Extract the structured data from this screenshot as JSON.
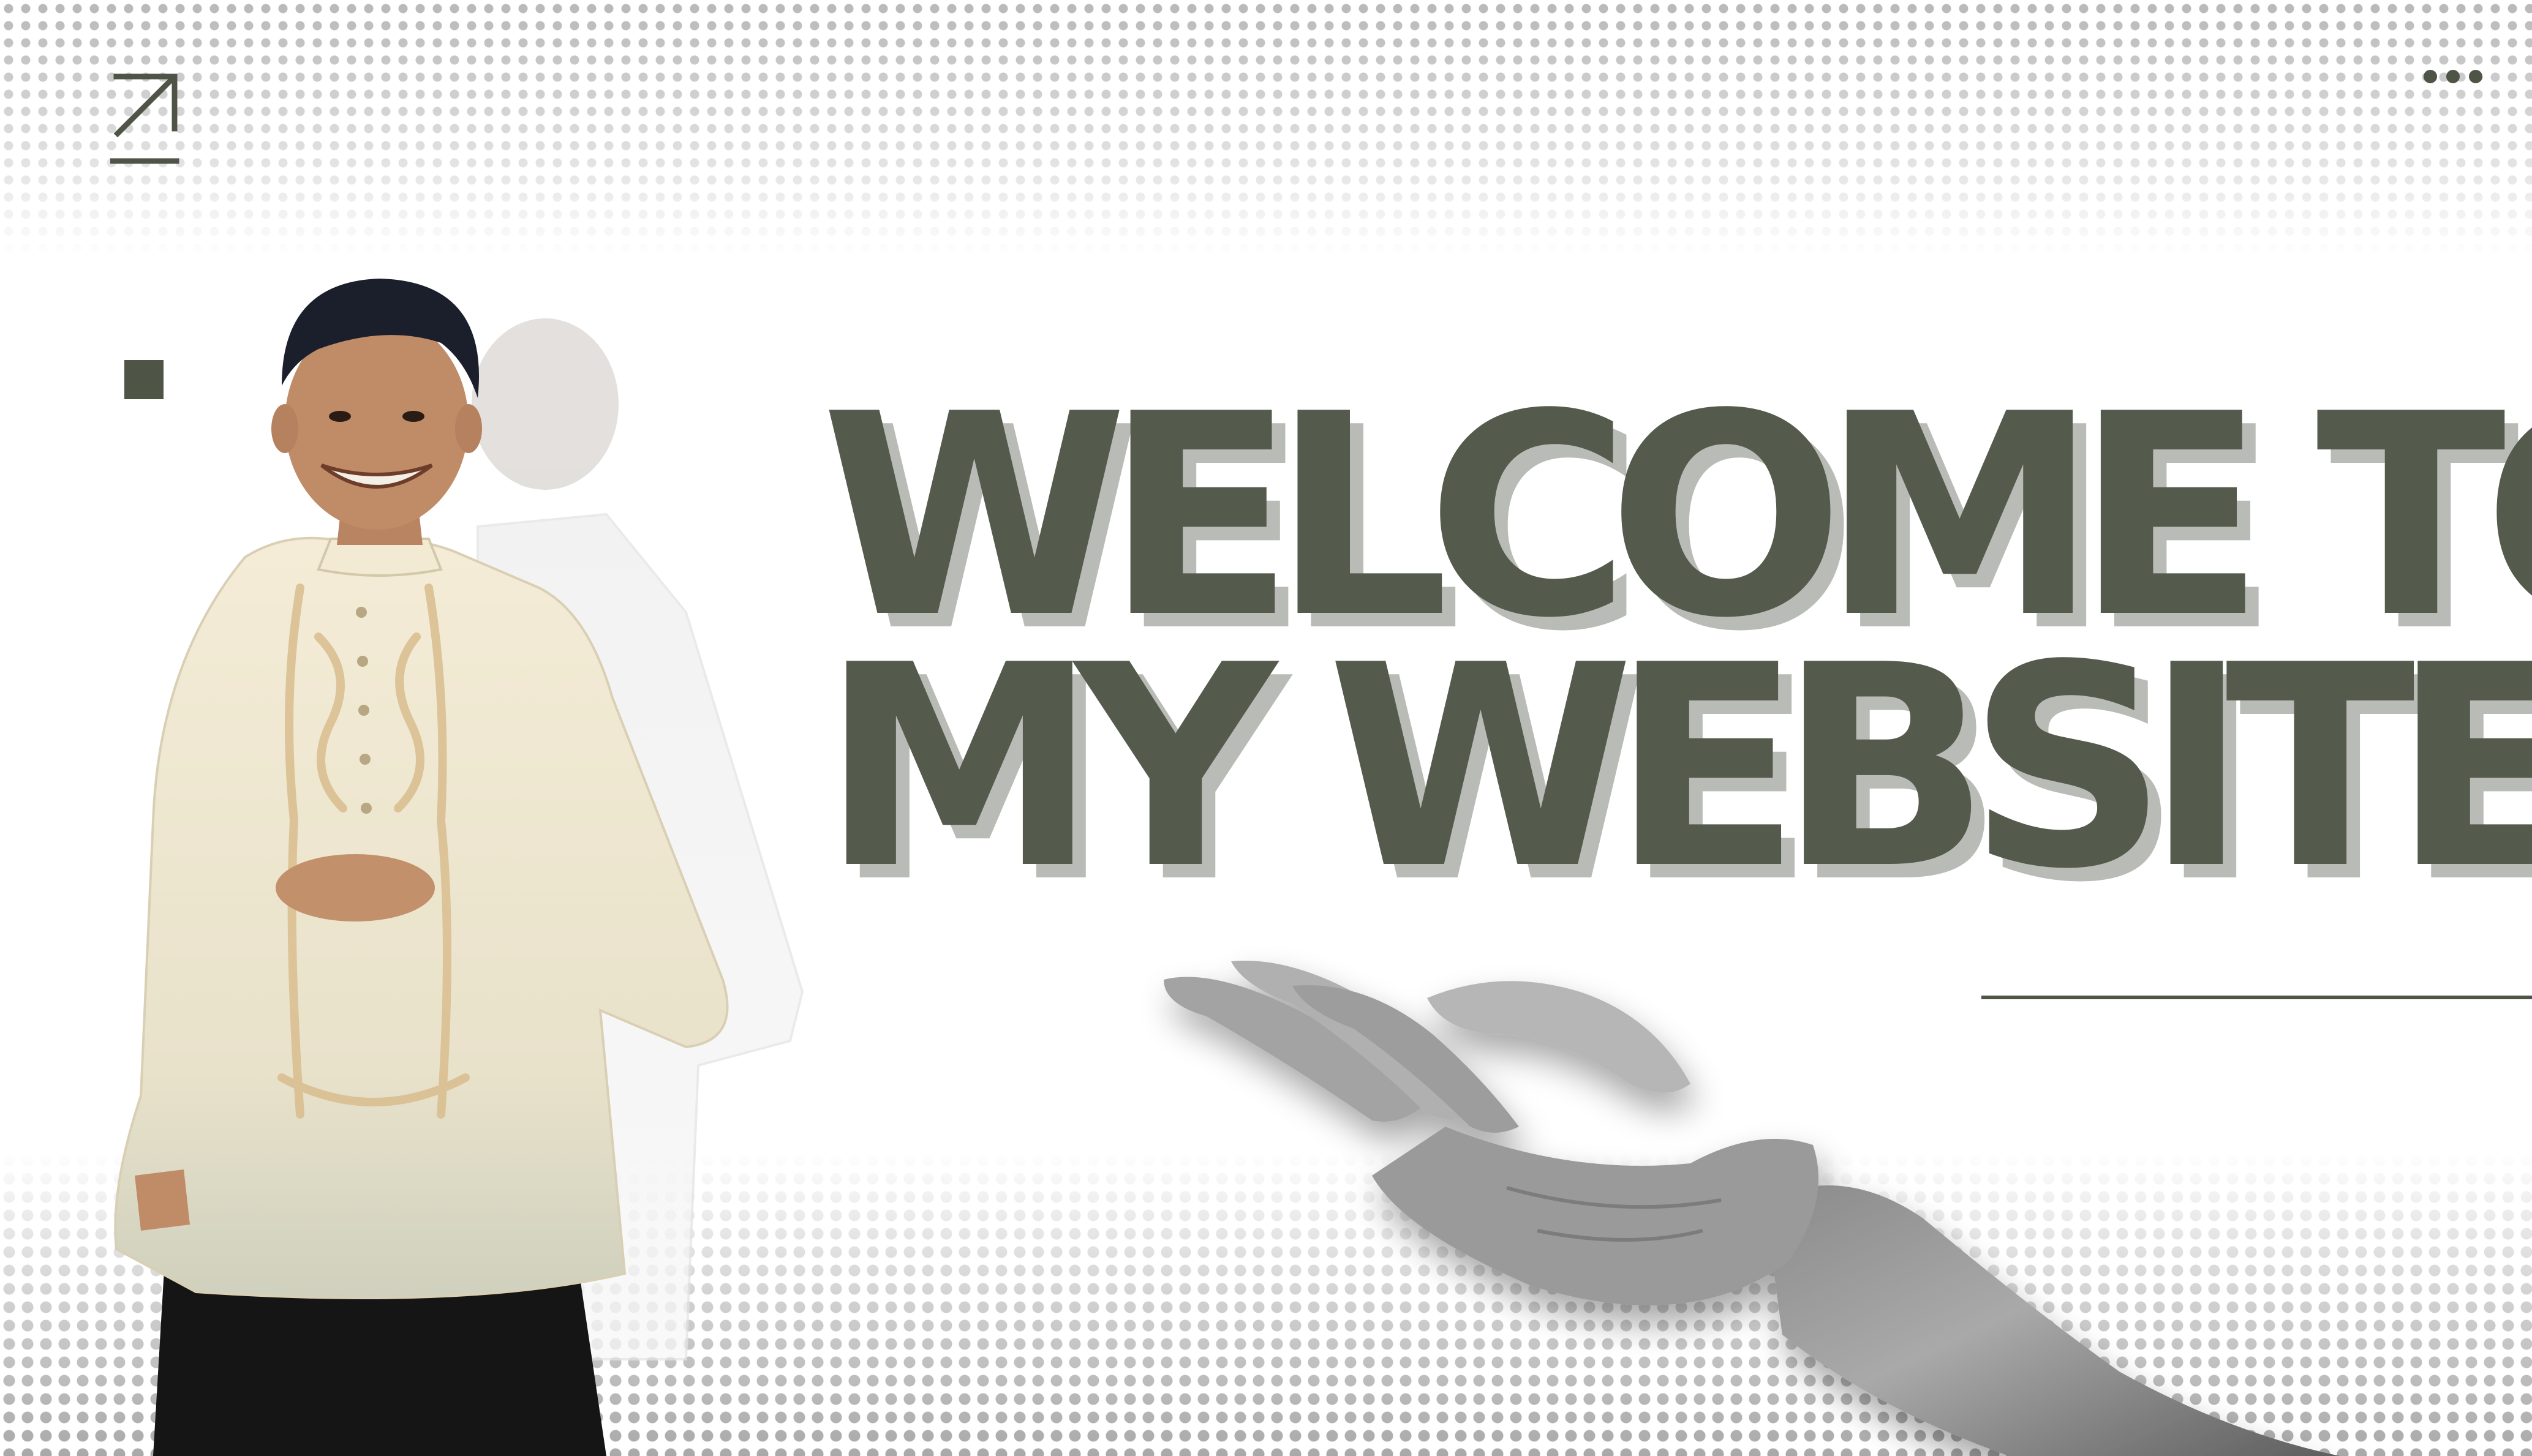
{
  "header": {
    "logo_icon": "arrow-up-right-icon",
    "menu_icon": "more-horizontal-icon"
  },
  "hero": {
    "headline_line1": "WELCOME TO",
    "headline_line2": "MY WEBSITE!"
  },
  "colors": {
    "headline": "#545b4c",
    "headline_shadow": "#b9bbb6",
    "accent": "#4e5547",
    "background": "#ffffff",
    "halftone": "#b0b0b0"
  }
}
